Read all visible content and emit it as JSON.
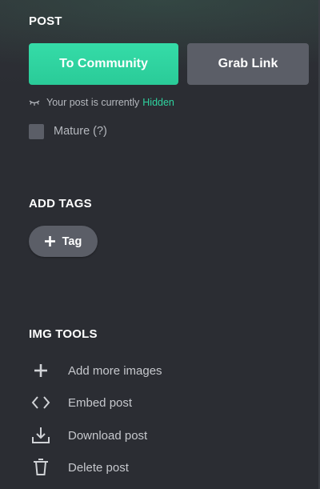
{
  "post_section": {
    "title": "POST",
    "to_community_label": "To Community",
    "grab_link_label": "Grab Link",
    "visibility_prefix": "Your post is currently",
    "visibility_state": "Hidden",
    "mature_label": "Mature (?)",
    "mature_checked": false
  },
  "tags_section": {
    "title": "ADD TAGS",
    "add_tag_label": "Tag"
  },
  "img_tools": {
    "title": "IMG TOOLS",
    "items": [
      {
        "label": "Add more images",
        "icon": "plus-icon"
      },
      {
        "label": "Embed post",
        "icon": "code-icon"
      },
      {
        "label": "Download post",
        "icon": "download-icon"
      },
      {
        "label": "Delete post",
        "icon": "trash-icon"
      }
    ]
  },
  "colors": {
    "background": "#2b2d33",
    "accent": "#2fd4a0",
    "secondary_button": "#5b5e67"
  }
}
